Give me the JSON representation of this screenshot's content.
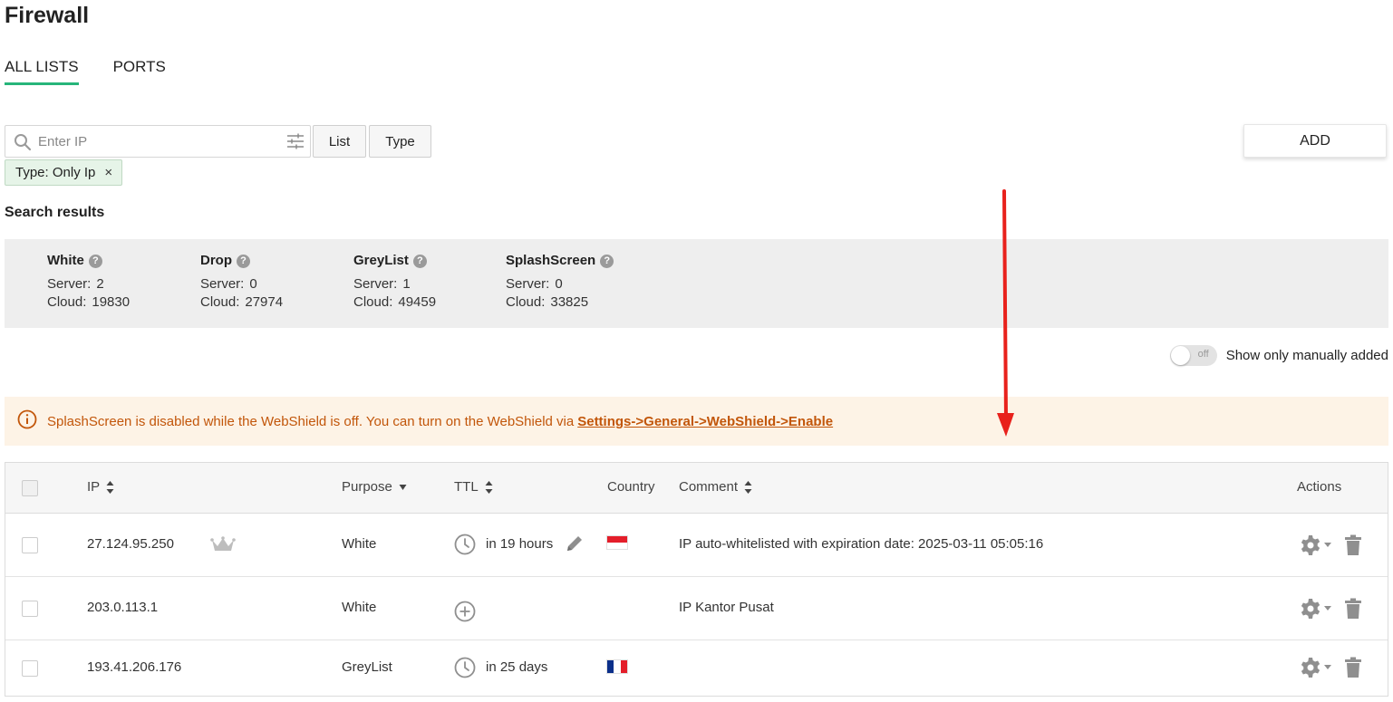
{
  "page": {
    "title": "Firewall"
  },
  "tabs": [
    {
      "label": "ALL LISTS",
      "active": true
    },
    {
      "label": "PORTS",
      "active": false
    }
  ],
  "search": {
    "placeholder": "Enter IP",
    "value": ""
  },
  "buttons": {
    "list": "List",
    "type": "Type",
    "add": "ADD"
  },
  "filter_chip": {
    "label": "Type: Only Ip",
    "close": "×"
  },
  "results": {
    "title": "Search results"
  },
  "summary": [
    {
      "name": "White",
      "server_label": "Server:",
      "server": "2",
      "cloud_label": "Cloud:",
      "cloud": "19830"
    },
    {
      "name": "Drop",
      "server_label": "Server:",
      "server": "0",
      "cloud_label": "Cloud:",
      "cloud": "27974"
    },
    {
      "name": "GreyList",
      "server_label": "Server:",
      "server": "1",
      "cloud_label": "Cloud:",
      "cloud": "49459"
    },
    {
      "name": "SplashScreen",
      "server_label": "Server:",
      "server": "0",
      "cloud_label": "Cloud:",
      "cloud": "33825"
    }
  ],
  "toggle": {
    "state_label": "off",
    "label": "Show only manually added",
    "on": false
  },
  "alert": {
    "text": "SplashScreen is disabled while the WebShield is off. You can turn on the WebShield via",
    "link": "Settings->General->WebShield->Enable"
  },
  "table": {
    "headers": {
      "ip": "IP",
      "purpose": "Purpose",
      "ttl": "TTL",
      "country": "Country",
      "comment": "Comment",
      "actions": "Actions"
    },
    "rows": [
      {
        "ip": "27.124.95.250",
        "crown": true,
        "purpose": "White",
        "ttl": "in 19 hours",
        "ttl_icon": "clock-icon",
        "editable": true,
        "country_flag": "indonesia-flag",
        "comment": "IP auto-whitelisted with expiration date: 2025-03-11 05:05:16"
      },
      {
        "ip": "203.0.113.1",
        "crown": false,
        "purpose": "White",
        "ttl": "",
        "ttl_icon": "plus-circle-icon",
        "editable": false,
        "country_flag": "",
        "comment": "IP Kantor Pusat"
      },
      {
        "ip": "193.41.206.176",
        "crown": false,
        "purpose": "GreyList",
        "ttl": "in 25 days",
        "ttl_icon": "clock-icon",
        "editable": false,
        "country_flag": "france-flag",
        "comment": ""
      }
    ]
  },
  "colors": {
    "accent": "#27b57a",
    "alert_text": "#c2560a",
    "alert_bg": "#fdf3e6",
    "summary_bg": "#eeeeee",
    "annotation_arrow": "#e8211c"
  }
}
